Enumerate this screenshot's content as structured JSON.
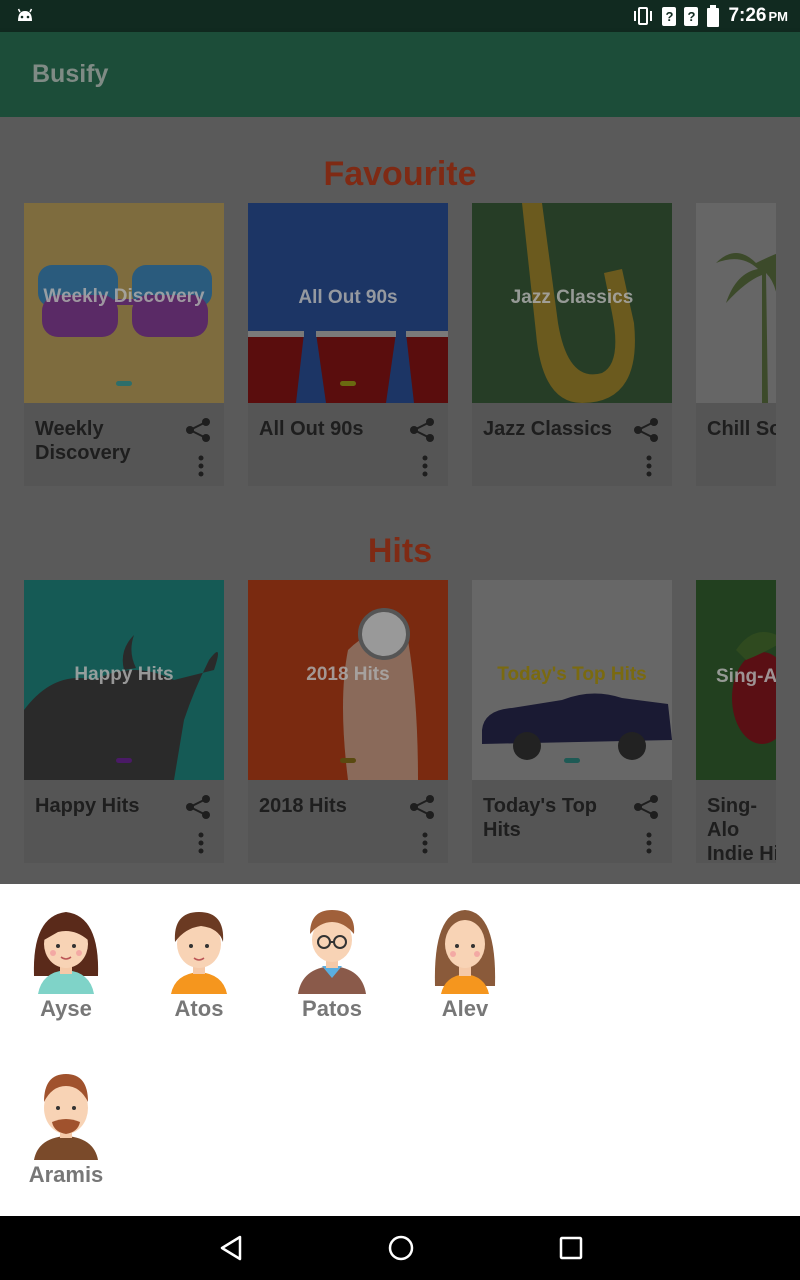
{
  "status_bar": {
    "time": "7:26",
    "ampm": "PM",
    "unknown_1": "?",
    "unknown_2": "?"
  },
  "app_bar": {
    "title": "Busify"
  },
  "sections": [
    {
      "title": "Favourite",
      "cards": [
        {
          "art_label": "Weekly Discovery",
          "name": "Weekly Discovery",
          "bg": "#7e6c3e"
        },
        {
          "art_label": "All Out 90s",
          "name": "All Out 90s",
          "bg": "#1c3565"
        },
        {
          "art_label": "Jazz Classics",
          "name": "Jazz Classics",
          "bg": "#263d26"
        },
        {
          "art_label": "",
          "name": "Chill Songs",
          "bg": "#666666"
        }
      ]
    },
    {
      "title": "Hits",
      "cards": [
        {
          "art_label": "Happy Hits",
          "name": "Happy Hits",
          "bg": "#155a55"
        },
        {
          "art_label": "2018 Hits",
          "name": "2018 Hits",
          "bg": "#7a2a10"
        },
        {
          "art_label": "Today's Top Hits",
          "name": "Today's Top Hits",
          "bg": "#676767"
        },
        {
          "art_label": "Sing-A",
          "name": "Sing-Alo Indie Hi",
          "bg": "#22401f"
        }
      ]
    }
  ],
  "contacts": [
    {
      "name": "Ayse"
    },
    {
      "name": "Atos"
    },
    {
      "name": "Patos"
    },
    {
      "name": "Alev"
    },
    {
      "name": "Aramis"
    }
  ],
  "colors": {
    "app_bar": "#1c4d39",
    "status_bar": "#112a20",
    "section_title": "#7f2a14",
    "sheet": "#ffffff"
  }
}
